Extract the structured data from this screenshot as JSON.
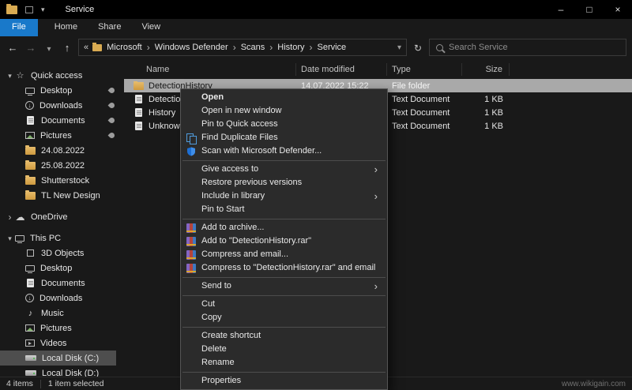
{
  "window": {
    "title": "Service",
    "controls": {
      "minimize": "–",
      "maximize": "□",
      "close": "×"
    }
  },
  "colors": {
    "accent_blue": "#1979ca",
    "selection_gray": "#a9a9a9",
    "menu_bg": "#2b2b2b",
    "titlebar_bg": "#000000"
  },
  "ribbon": {
    "tabs": [
      {
        "label": "File"
      },
      {
        "label": "Home"
      },
      {
        "label": "Share"
      },
      {
        "label": "View"
      }
    ]
  },
  "address_bar": {
    "overflow_indicator": "«",
    "crumbs": [
      "Microsoft",
      "Windows Defender",
      "Scans",
      "History",
      "Service"
    ],
    "search_placeholder": "Search Service"
  },
  "sidebar": {
    "items": [
      {
        "label": "Quick access",
        "icon": "star"
      },
      {
        "label": "Desktop",
        "icon": "monitor",
        "pinned": true
      },
      {
        "label": "Downloads",
        "icon": "download-circle",
        "pinned": true
      },
      {
        "label": "Documents",
        "icon": "document",
        "pinned": true
      },
      {
        "label": "Pictures",
        "icon": "pictures",
        "pinned": true
      },
      {
        "label": "24.08.2022",
        "icon": "folder"
      },
      {
        "label": "25.08.2022",
        "icon": "folder"
      },
      {
        "label": "Shutterstock",
        "icon": "folder"
      },
      {
        "label": "TL New Design",
        "icon": "folder"
      },
      {
        "label": "OneDrive",
        "icon": "cloud"
      },
      {
        "label": "This PC",
        "icon": "computer"
      },
      {
        "label": "3D Objects",
        "icon": "cube"
      },
      {
        "label": "Desktop",
        "icon": "monitor"
      },
      {
        "label": "Documents",
        "icon": "document"
      },
      {
        "label": "Downloads",
        "icon": "download-circle"
      },
      {
        "label": "Music",
        "icon": "music-note"
      },
      {
        "label": "Pictures",
        "icon": "pictures"
      },
      {
        "label": "Videos",
        "icon": "film"
      },
      {
        "label": "Local Disk (C:)",
        "icon": "drive",
        "selected": true
      },
      {
        "label": "Local Disk (D:)",
        "icon": "drive"
      }
    ]
  },
  "file_list": {
    "columns": [
      "Name",
      "Date modified",
      "Type",
      "Size"
    ],
    "rows": [
      {
        "name": "DetectionHistory",
        "date": "14.07.2022 15:22",
        "type": "File folder",
        "size": "",
        "icon": "folder",
        "selected": true
      },
      {
        "name": "DetectionHistory",
        "date": "",
        "type": "Text Document",
        "size": "1 KB",
        "icon": "text-document"
      },
      {
        "name": "History",
        "date": "",
        "type": "Text Document",
        "size": "1 KB",
        "icon": "text-document"
      },
      {
        "name": "Unknown",
        "date": "",
        "type": "Text Document",
        "size": "1 KB",
        "icon": "text-document"
      }
    ]
  },
  "context_menu": {
    "items": [
      {
        "label": "Open",
        "bold": true
      },
      {
        "label": "Open in new window"
      },
      {
        "label": "Pin to Quick access"
      },
      {
        "label": "Find Duplicate Files",
        "icon": "duplicate-files"
      },
      {
        "label": "Scan with Microsoft Defender...",
        "icon": "defender-shield"
      },
      {
        "label": "Give access to",
        "submenu": true
      },
      {
        "label": "Restore previous versions"
      },
      {
        "label": "Include in library",
        "submenu": true
      },
      {
        "label": "Pin to Start"
      },
      {
        "label": "Add to archive...",
        "icon": "winrar"
      },
      {
        "label": "Add to \"DetectionHistory.rar\"",
        "icon": "winrar"
      },
      {
        "label": "Compress and email...",
        "icon": "winrar"
      },
      {
        "label": "Compress to \"DetectionHistory.rar\" and email",
        "icon": "winrar"
      },
      {
        "label": "Send to",
        "submenu": true
      },
      {
        "label": "Cut"
      },
      {
        "label": "Copy"
      },
      {
        "label": "Create shortcut"
      },
      {
        "label": "Delete"
      },
      {
        "label": "Rename"
      },
      {
        "label": "Properties"
      }
    ]
  },
  "status_bar": {
    "items_count": "4 items",
    "selection": "1 item selected",
    "watermark": "www.wikigain.com"
  }
}
